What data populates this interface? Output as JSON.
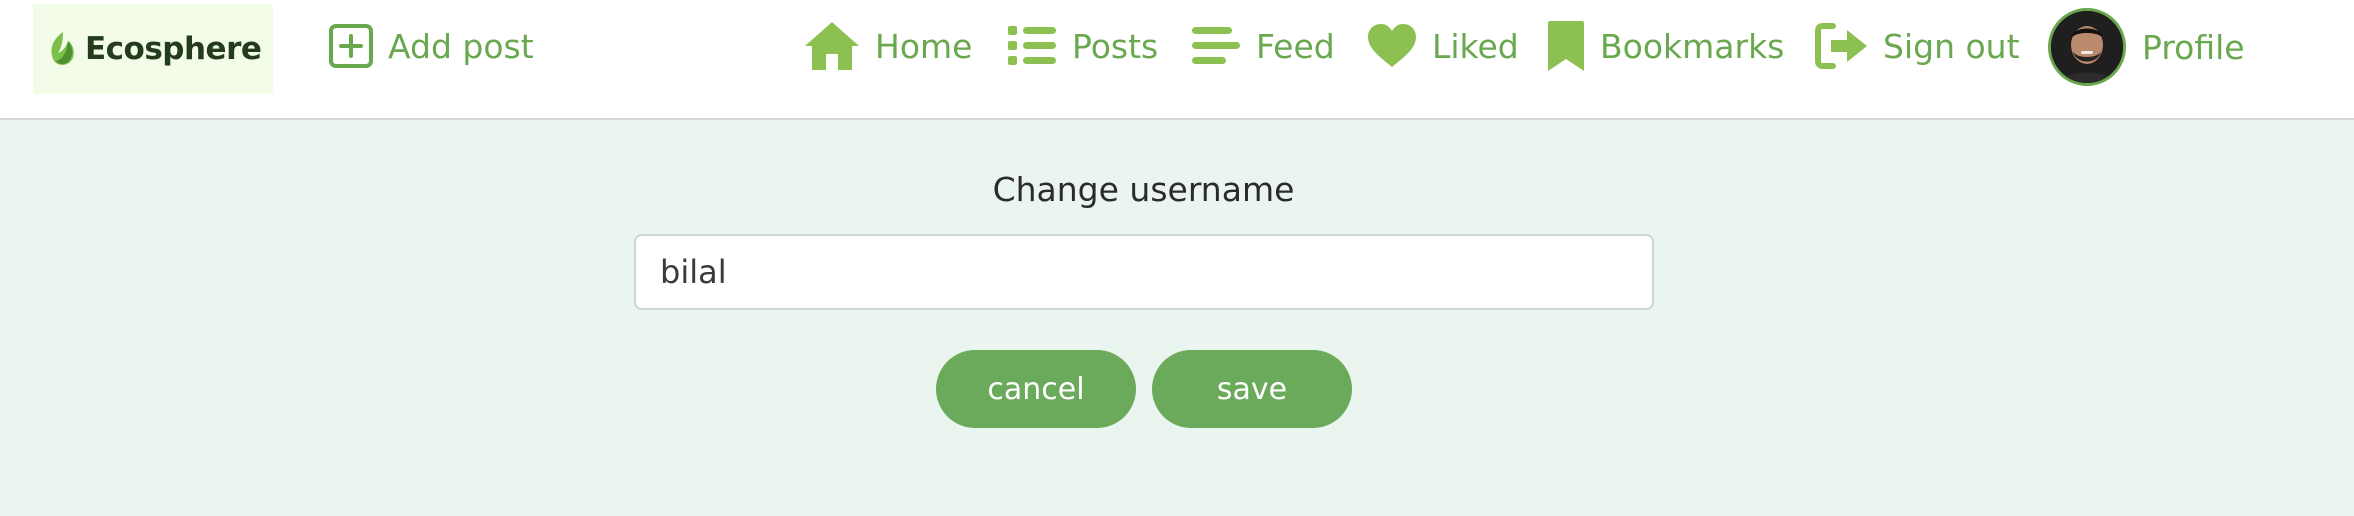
{
  "brand": {
    "name": "Ecosphere"
  },
  "header": {
    "add_post": "Add post",
    "nav": [
      {
        "label": "Home",
        "icon": "home-icon"
      },
      {
        "label": "Posts",
        "icon": "list-icon"
      },
      {
        "label": "Feed",
        "icon": "feed-lines-icon"
      },
      {
        "label": "Liked",
        "icon": "heart-icon"
      },
      {
        "label": "Bookmarks",
        "icon": "bookmark-icon"
      },
      {
        "label": "Sign out",
        "icon": "sign-out-icon"
      }
    ],
    "profile_label": "Profile"
  },
  "form": {
    "title": "Change username",
    "username_value": "bilal",
    "cancel_label": "cancel",
    "save_label": "save"
  },
  "colors": {
    "accent": "#6aa84f",
    "button": "#6aaa5a",
    "background": "#eaf5ef",
    "logo_bg": "#f3fbe9"
  }
}
